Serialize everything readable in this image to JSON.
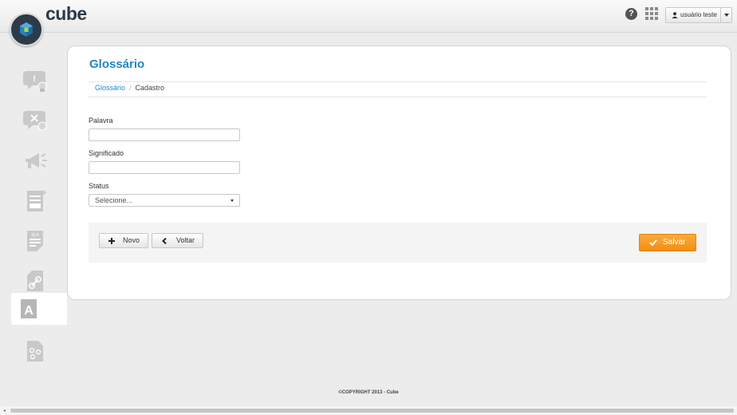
{
  "app": {
    "name": "cube"
  },
  "header": {
    "help_label": "?",
    "user_label": "usuário teste"
  },
  "page": {
    "title": "Glossário",
    "breadcrumb": {
      "root": "Glossário",
      "separator": "/",
      "current": "Cadastro"
    }
  },
  "form": {
    "palavra": {
      "label": "Palavra",
      "value": ""
    },
    "significado": {
      "label": "Significado",
      "value": ""
    },
    "status": {
      "label": "Status",
      "selected": "Selecione..."
    }
  },
  "actions": {
    "novo_label": "Novo",
    "voltar_label": "Voltar",
    "salvar_label": "Salvar"
  },
  "footer": {
    "text": "©COPYRIGHT 2013 - Cube"
  },
  "sidebar": {
    "icons": [
      "support-ticket-icon",
      "ticket-cancel-icon",
      "megaphone-icon",
      "form-document-icon",
      "sla-document-icon",
      "link-document-icon",
      "glossary-icon",
      "workflow-document-icon"
    ]
  },
  "colors": {
    "accent": "#1f87c9",
    "save": "#f39a20",
    "sidebar_icon": "#c9c9c9"
  }
}
